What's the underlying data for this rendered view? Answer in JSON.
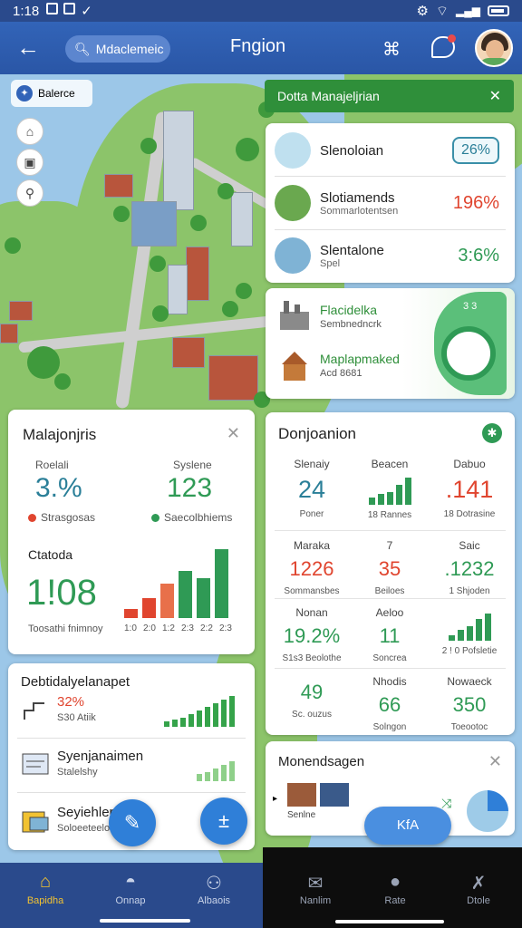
{
  "status": {
    "time": "1:18"
  },
  "appbar": {
    "search_text": "Mdaclemeic",
    "title": "Fngion"
  },
  "map": {
    "legend": "Balerce"
  },
  "banner": {
    "text": "Dotta Manajeljrian"
  },
  "top_card": {
    "rows": [
      {
        "title": "Slenoloian",
        "subtitle": "",
        "value": "26%",
        "value_color": "#2a7f98"
      },
      {
        "title": "Slotiamends",
        "subtitle": "Sommarlotentsen",
        "value": "196%",
        "value_color": "#e0452f"
      },
      {
        "title": "Slentalone",
        "subtitle": "Spel",
        "value": "3:6%",
        "value_color": "#2f9a55"
      }
    ]
  },
  "green_card": {
    "rows": [
      {
        "title": "Flacidelka",
        "subtitle": "Sembnedncrk"
      },
      {
        "title": "Maplapmaked",
        "subtitle": "Acd 8681"
      }
    ],
    "arc_label": "3 3"
  },
  "left_card": {
    "title": "Malajonjris",
    "col1_label": "Roelali",
    "col1_value": "3.%",
    "col1_legend": "Strasgosas",
    "col2_label": "Syslene",
    "col2_value": "123",
    "col2_legend": "Saecolbhiems",
    "big_label": "Ctatoda",
    "big_value": "1!08",
    "big_caption": "Toosathi fnimnoy",
    "bar_ticks": [
      "1:0",
      "2:0",
      "1:2",
      "2:3",
      "2:2",
      "2:3"
    ]
  },
  "grid_card": {
    "title": "Donjoanion",
    "cells": [
      {
        "label": "Slenaiy",
        "value": "24",
        "sub": "Poner",
        "color": "#2a7f98"
      },
      {
        "label": "Beacen",
        "value": "",
        "sub": "18 Rannes",
        "color": "#2f9a55"
      },
      {
        "label": "Dabuo",
        "value": ".141",
        "sub": "18 Dotrasine",
        "color": "#e0452f"
      },
      {
        "label": "Maraka",
        "value": "1226",
        "sub": "Sommansbes",
        "color": "#e0452f"
      },
      {
        "label": "7",
        "value": "35",
        "sub": "Beiloes",
        "color": "#e0452f"
      },
      {
        "label": "Saic",
        "value": ".1232",
        "sub": "1 Shjoden",
        "color": "#2f9a55"
      },
      {
        "label": "Nonan",
        "value": "19.2%",
        "sub": "S1s3 Beolothe",
        "color": "#2f9a55"
      },
      {
        "label": "Aeloo",
        "value": "11",
        "sub": "Soncrea",
        "color": "#2f9a55"
      },
      {
        "label": "",
        "value": "",
        "sub": "2 ! 0 Pofsletie",
        "color": "#2f9a55"
      },
      {
        "label": "",
        "value": "49",
        "sub": "Sc. ouzus",
        "color": "#2f9a55"
      },
      {
        "label": "Nhodis",
        "value": "66",
        "sub": "Solngon",
        "color": "#2f9a55"
      },
      {
        "label": "Nowaeck",
        "value": "350",
        "sub": "Toeootoc",
        "color": "#2f9a55"
      }
    ]
  },
  "list_card": {
    "title": "Debtidalyelanapet",
    "rows": [
      {
        "title": "32%",
        "subtitle": "S30 Atiik",
        "title_color": "#e0452f"
      },
      {
        "title": "Syenjanaimen",
        "subtitle": "Stalelshy",
        "title_color": "#222222"
      },
      {
        "title": "Seyiehler",
        "subtitle": "Soloeeteeloons",
        "title_color": "#222222"
      }
    ]
  },
  "monitor_card": {
    "title": "Monendsagen",
    "caption": "Senlne"
  },
  "pill_button": "KfA",
  "nav": {
    "items": [
      {
        "label": "Bapidha",
        "active": true
      },
      {
        "label": "Onnap",
        "active": false
      },
      {
        "label": "Albaois",
        "active": false
      },
      {
        "label": "Nanlim",
        "active": false
      },
      {
        "label": "Rate",
        "active": false
      },
      {
        "label": "Dtole",
        "active": false
      }
    ]
  },
  "colors": {
    "primary": "#2a56a6",
    "accent_green": "#2f9a55",
    "accent_red": "#e0452f",
    "accent_teal": "#2a7f98"
  }
}
